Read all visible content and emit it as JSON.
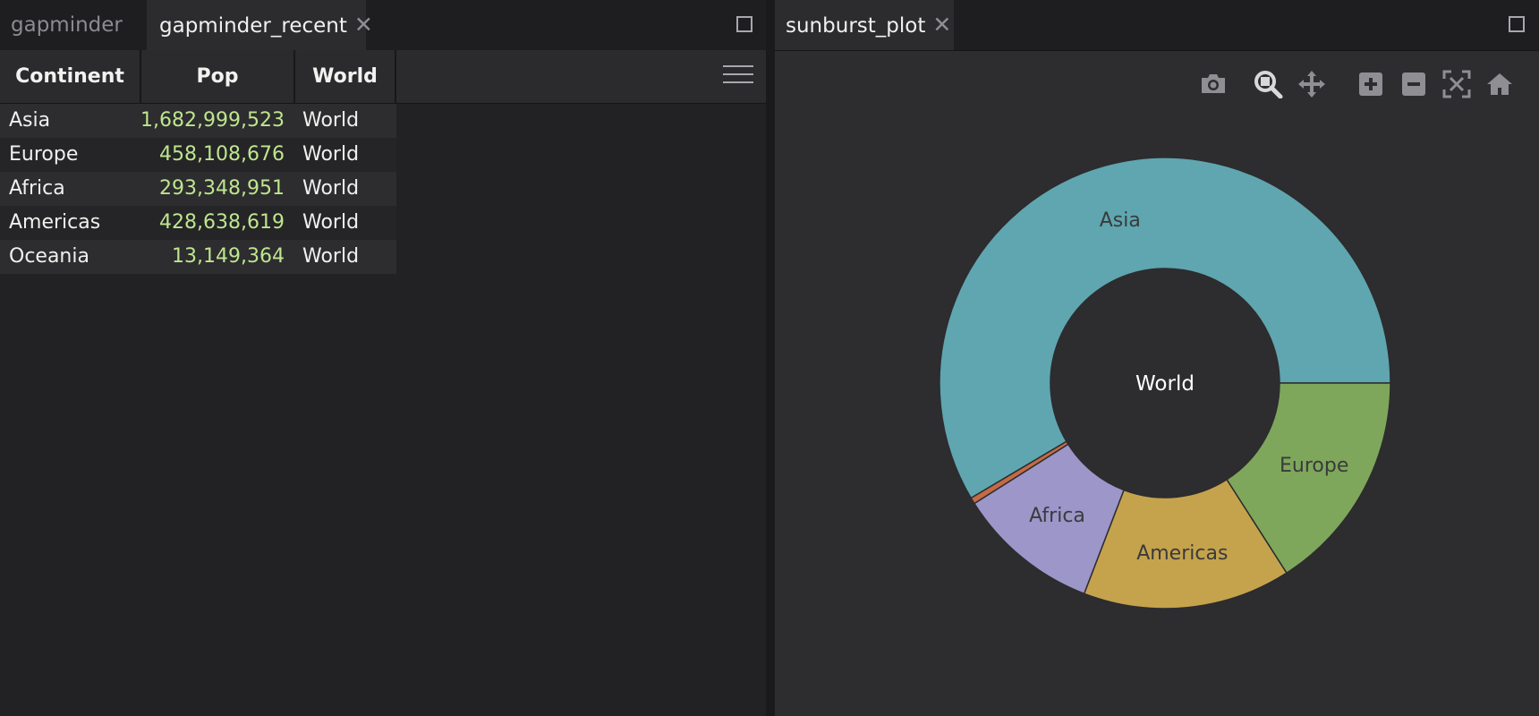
{
  "left": {
    "tabs": [
      {
        "label": "gapminder",
        "active": false
      },
      {
        "label": "gapminder_recent",
        "active": true
      }
    ],
    "close_glyph": "✕",
    "grid": {
      "columns": [
        "Continent",
        "Pop",
        "World"
      ],
      "rows": [
        {
          "continent": "Asia",
          "pop": "1,682,999,523",
          "world": "World"
        },
        {
          "continent": "Europe",
          "pop": "458,108,676",
          "world": "World"
        },
        {
          "continent": "Africa",
          "pop": "293,348,951",
          "world": "World"
        },
        {
          "continent": "Americas",
          "pop": "428,638,619",
          "world": "World"
        },
        {
          "continent": "Oceania",
          "pop": "13,149,364",
          "world": "World"
        }
      ],
      "menu_icon": "hamburger-menu-icon"
    }
  },
  "right": {
    "tabs": [
      {
        "label": "sunburst_plot",
        "active": true
      }
    ],
    "toolbar_icons": [
      "camera-icon",
      "zoom-icon",
      "pan-icon",
      "zoom-in-icon",
      "zoom-out-icon",
      "autoscale-icon",
      "reset-axes-icon"
    ]
  },
  "colors": {
    "pop_text": "#bde68e",
    "asia": "#5fa6b0",
    "europe": "#7ea75b",
    "africa": "#9c96c9",
    "americas": "#c5a34d",
    "oceania": "#c46a45"
  },
  "chart_data": {
    "type": "sunburst",
    "root": "World",
    "labels": [
      "Asia",
      "Europe",
      "Africa",
      "Americas",
      "Oceania"
    ],
    "values": [
      1682999523,
      458108676,
      293348951,
      428638619,
      13149364
    ],
    "order": [
      "Asia",
      "Oceania",
      "Africa",
      "Americas",
      "Europe"
    ],
    "colors": [
      "#5fa6b0",
      "#c46a45",
      "#9c96c9",
      "#c5a34d",
      "#7ea75b"
    ]
  }
}
